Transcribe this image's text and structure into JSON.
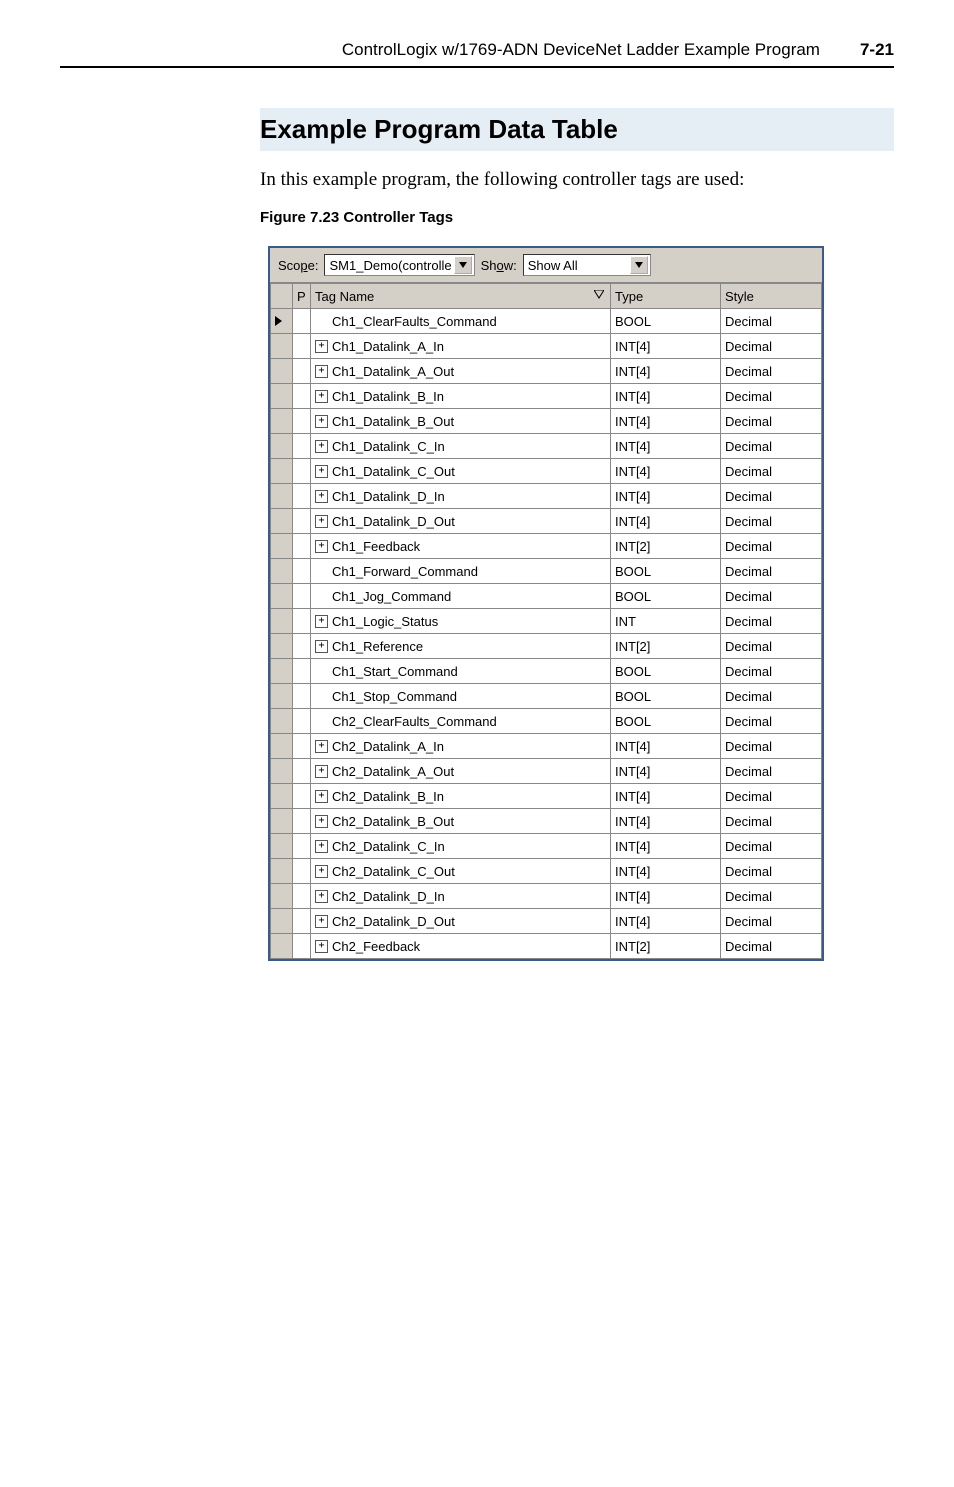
{
  "header": {
    "title": "ControlLogix w/1769-ADN DeviceNet Ladder Example Program",
    "pagenum": "7-21"
  },
  "section": {
    "title": "Example Program Data Table",
    "intro": "In this example program, the following controller tags are used:",
    "figure_caption": "Figure 7.23   Controller Tags"
  },
  "toolbar": {
    "scope_label": "Scope:",
    "scope_value": "SM1_Demo(controlle",
    "show_label": "Show:",
    "show_value": "Show All"
  },
  "grid": {
    "headers": {
      "p": "P",
      "name": "Tag Name",
      "type": "Type",
      "style": "Style"
    },
    "rows": [
      {
        "selected": true,
        "expand": "",
        "name": "Ch1_ClearFaults_Command",
        "type": "BOOL",
        "style": "Decimal"
      },
      {
        "selected": false,
        "expand": "+",
        "name": "Ch1_Datalink_A_In",
        "type": "INT[4]",
        "style": "Decimal"
      },
      {
        "selected": false,
        "expand": "+",
        "name": "Ch1_Datalink_A_Out",
        "type": "INT[4]",
        "style": "Decimal"
      },
      {
        "selected": false,
        "expand": "+",
        "name": "Ch1_Datalink_B_In",
        "type": "INT[4]",
        "style": "Decimal"
      },
      {
        "selected": false,
        "expand": "+",
        "name": "Ch1_Datalink_B_Out",
        "type": "INT[4]",
        "style": "Decimal"
      },
      {
        "selected": false,
        "expand": "+",
        "name": "Ch1_Datalink_C_In",
        "type": "INT[4]",
        "style": "Decimal"
      },
      {
        "selected": false,
        "expand": "+",
        "name": "Ch1_Datalink_C_Out",
        "type": "INT[4]",
        "style": "Decimal"
      },
      {
        "selected": false,
        "expand": "+",
        "name": "Ch1_Datalink_D_In",
        "type": "INT[4]",
        "style": "Decimal"
      },
      {
        "selected": false,
        "expand": "+",
        "name": "Ch1_Datalink_D_Out",
        "type": "INT[4]",
        "style": "Decimal"
      },
      {
        "selected": false,
        "expand": "+",
        "name": "Ch1_Feedback",
        "type": "INT[2]",
        "style": "Decimal"
      },
      {
        "selected": false,
        "expand": "",
        "name": "Ch1_Forward_Command",
        "type": "BOOL",
        "style": "Decimal"
      },
      {
        "selected": false,
        "expand": "",
        "name": "Ch1_Jog_Command",
        "type": "BOOL",
        "style": "Decimal"
      },
      {
        "selected": false,
        "expand": "+",
        "name": "Ch1_Logic_Status",
        "type": "INT",
        "style": "Decimal"
      },
      {
        "selected": false,
        "expand": "+",
        "name": "Ch1_Reference",
        "type": "INT[2]",
        "style": "Decimal"
      },
      {
        "selected": false,
        "expand": "",
        "name": "Ch1_Start_Command",
        "type": "BOOL",
        "style": "Decimal"
      },
      {
        "selected": false,
        "expand": "",
        "name": "Ch1_Stop_Command",
        "type": "BOOL",
        "style": "Decimal"
      },
      {
        "selected": false,
        "expand": "",
        "name": "Ch2_ClearFaults_Command",
        "type": "BOOL",
        "style": "Decimal"
      },
      {
        "selected": false,
        "expand": "+",
        "name": "Ch2_Datalink_A_In",
        "type": "INT[4]",
        "style": "Decimal"
      },
      {
        "selected": false,
        "expand": "+",
        "name": "Ch2_Datalink_A_Out",
        "type": "INT[4]",
        "style": "Decimal"
      },
      {
        "selected": false,
        "expand": "+",
        "name": "Ch2_Datalink_B_In",
        "type": "INT[4]",
        "style": "Decimal"
      },
      {
        "selected": false,
        "expand": "+",
        "name": "Ch2_Datalink_B_Out",
        "type": "INT[4]",
        "style": "Decimal"
      },
      {
        "selected": false,
        "expand": "+",
        "name": "Ch2_Datalink_C_In",
        "type": "INT[4]",
        "style": "Decimal"
      },
      {
        "selected": false,
        "expand": "+",
        "name": "Ch2_Datalink_C_Out",
        "type": "INT[4]",
        "style": "Decimal"
      },
      {
        "selected": false,
        "expand": "+",
        "name": "Ch2_Datalink_D_In",
        "type": "INT[4]",
        "style": "Decimal"
      },
      {
        "selected": false,
        "expand": "+",
        "name": "Ch2_Datalink_D_Out",
        "type": "INT[4]",
        "style": "Decimal"
      },
      {
        "selected": false,
        "expand": "+",
        "name": "Ch2_Feedback",
        "type": "INT[2]",
        "style": "Decimal"
      }
    ]
  }
}
